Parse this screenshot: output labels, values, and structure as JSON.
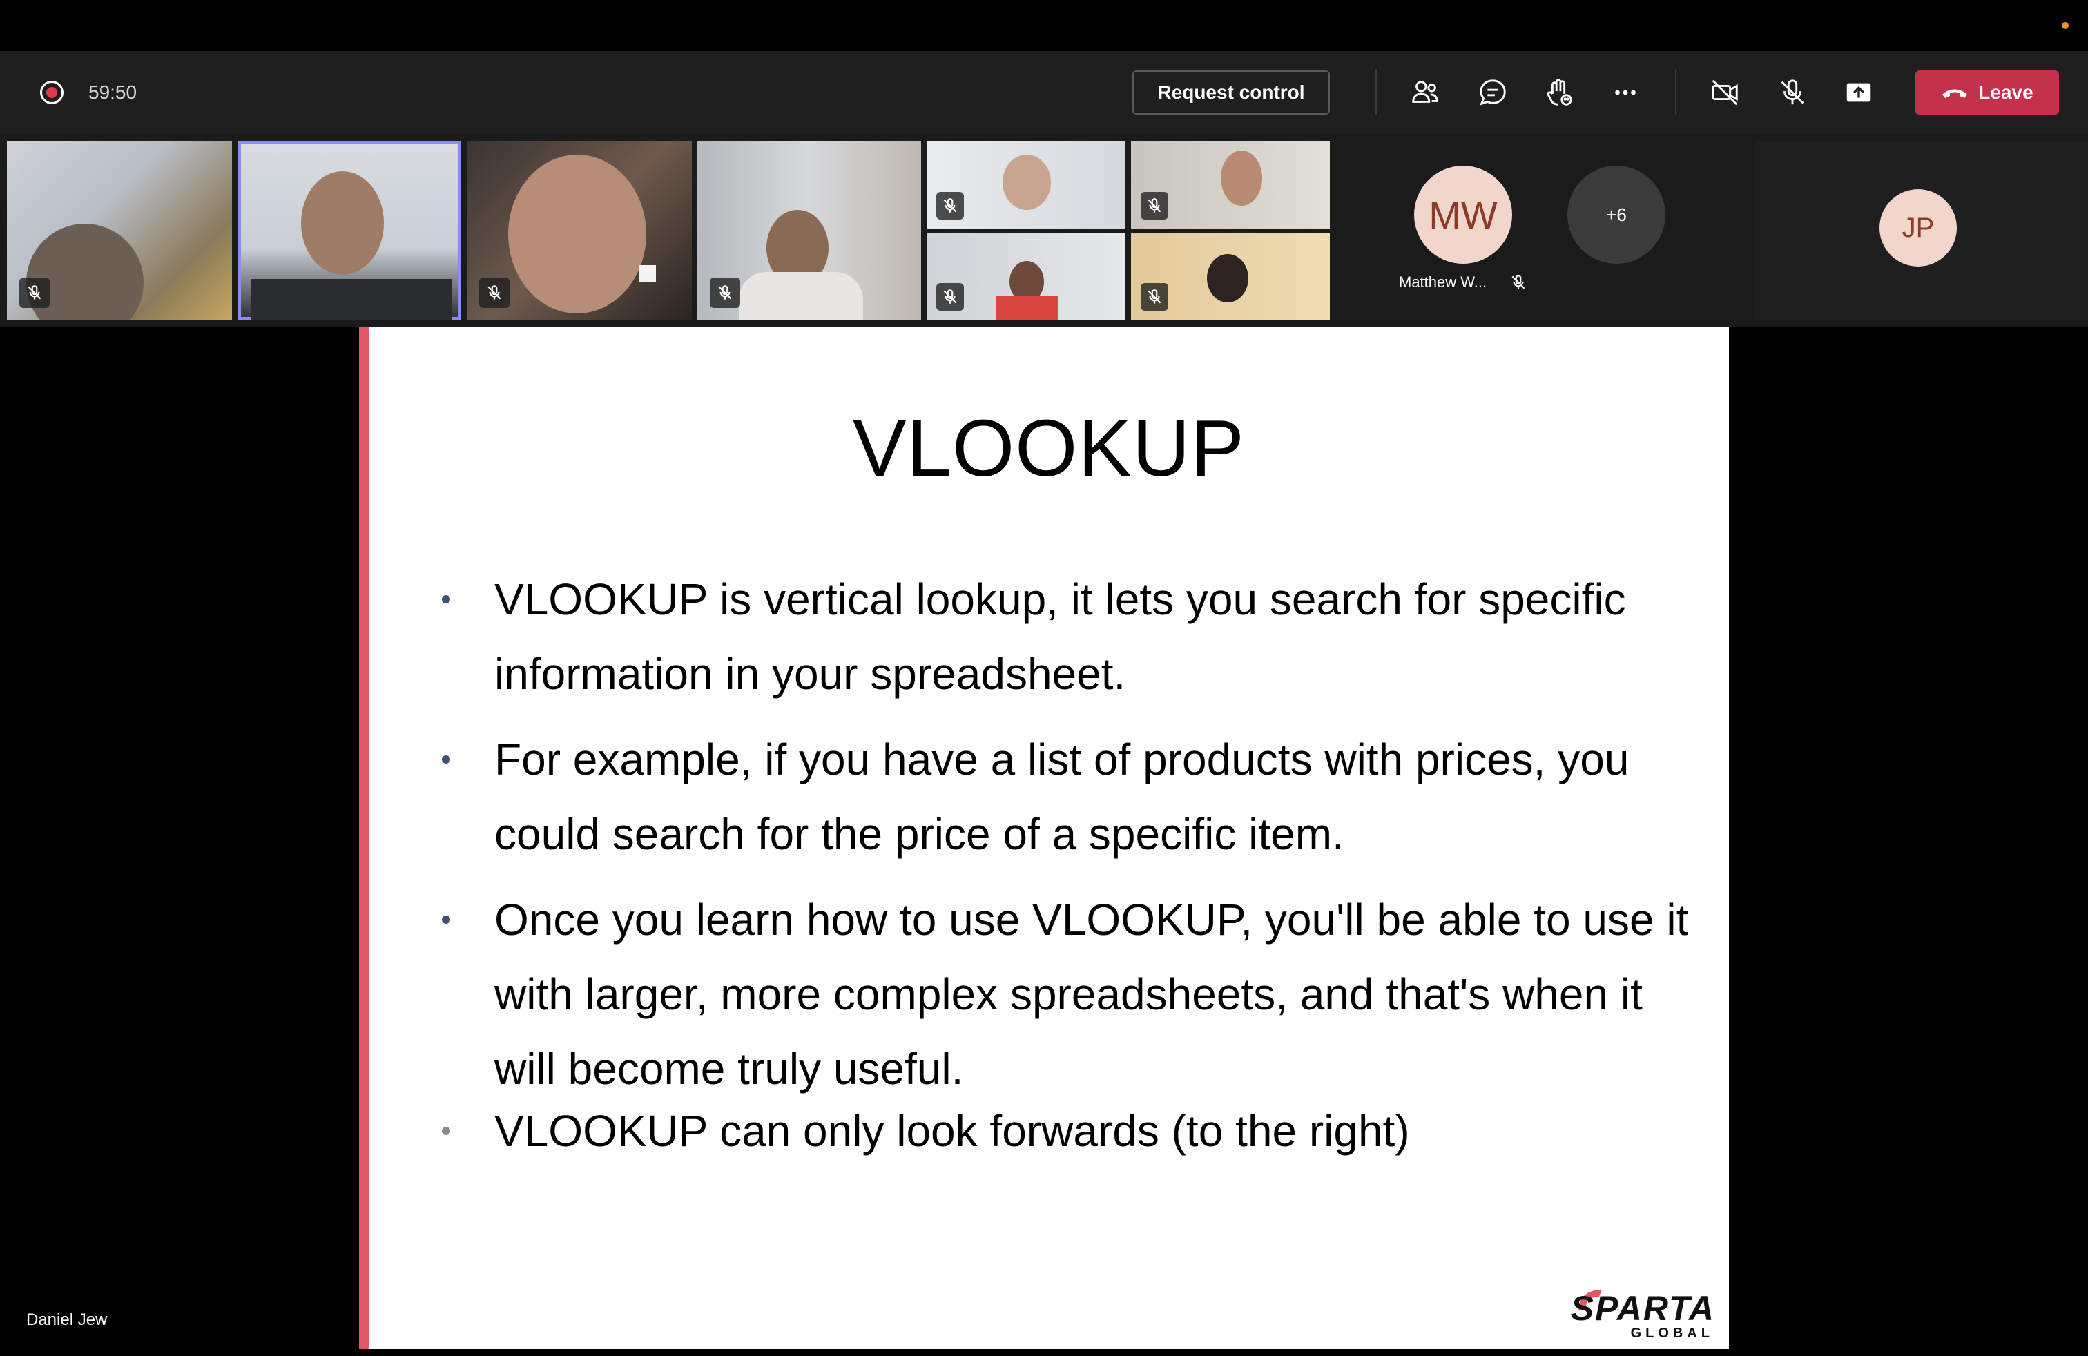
{
  "toolbar": {
    "timer": "59:50",
    "request_control_label": "Request control",
    "leave_label": "Leave"
  },
  "gallery": {
    "avatars": [
      {
        "initials": "MW",
        "name": "Matthew W..."
      },
      {
        "initials": "JP"
      }
    ],
    "more_count": "+6"
  },
  "slide": {
    "title": "VLOOKUP",
    "bullets": [
      "VLOOKUP is vertical lookup, it lets you search for specific information in your spreadsheet.",
      "For example, if you have a list of products with prices, you could search for the price of a specific item.",
      "Once you learn how to use VLOOKUP, you'll be able to use it with larger, more complex spreadsheets, and that's when it will become truly useful.",
      "VLOOKUP can only look forwards (to the right)"
    ],
    "logo_text": "SPARTA",
    "logo_subtext": "GLOBAL"
  },
  "presenter": {
    "name": "Daniel Jew"
  },
  "colors": {
    "accent_leave": "#c4314b",
    "active_speaker": "#8b8cf0",
    "slide_accent": "#e05a66",
    "avatar_bg": "#f2d6cc"
  }
}
